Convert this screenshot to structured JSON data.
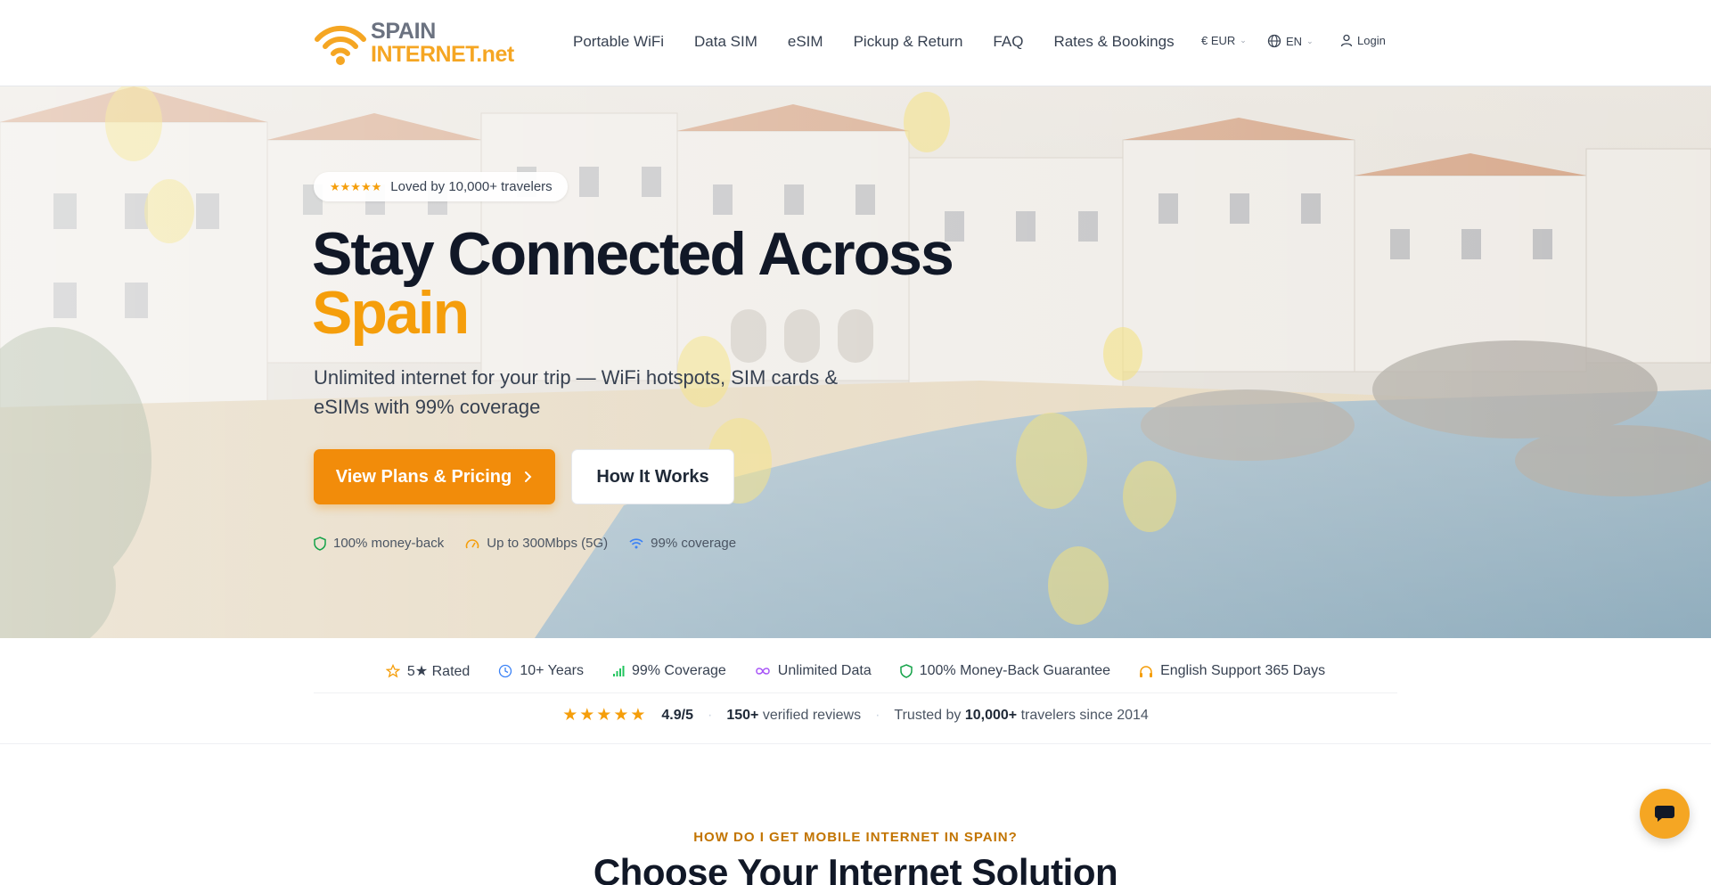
{
  "brand": {
    "line1": "SPAIN",
    "line2": "INTERNET.net"
  },
  "nav": [
    "Portable WiFi",
    "Data SIM",
    "eSIM",
    "Pickup & Return",
    "FAQ",
    "Rates & Bookings"
  ],
  "utility": {
    "currency": "€ EUR",
    "language": "EN",
    "login": "Login"
  },
  "hero": {
    "badge_stars": "★★★★★",
    "badge_text": "Loved by 10,000+ travelers",
    "title_line1": "Stay Connected Across",
    "title_line2": "Spain",
    "subtitle": "Unlimited internet for your trip — WiFi hotspots, SIM cards & eSIMs with 99% coverage",
    "primary_cta": "View Plans & Pricing",
    "secondary_cta": "How It Works",
    "features": [
      "100% money-back",
      "Up to 300Mbps (5G)",
      "99% coverage"
    ]
  },
  "trust": {
    "items": [
      "5★ Rated",
      "10+ Years",
      "99% Coverage",
      "Unlimited Data",
      "100% Money-Back Guarantee",
      "English Support 365 Days"
    ],
    "rating_stars": "★★★★★",
    "rating": "4.9/5",
    "reviews_count": "150+",
    "reviews_label": "verified reviews",
    "trusted_prefix": "Trusted by",
    "trusted_count": "10,000+",
    "trusted_suffix": "travelers since 2014"
  },
  "section": {
    "eyebrow": "HOW DO I GET MOBILE INTERNET IN SPAIN?",
    "title": "Choose Your Internet Solution"
  },
  "colors": {
    "accent": "#f59e0b",
    "primary_button": "#f28c0a",
    "text_dark": "#111827"
  }
}
